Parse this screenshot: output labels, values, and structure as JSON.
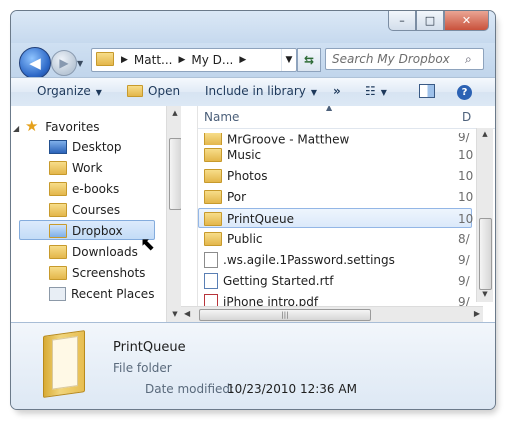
{
  "window": {
    "caption_buttons": {
      "minimize": "–",
      "maximize": "□",
      "close": "✕"
    }
  },
  "nav": {
    "back": "◀",
    "forward": "▶",
    "address": [
      "Matt...",
      "My D..."
    ],
    "search_placeholder": "Search My Dropbox"
  },
  "toolbar": {
    "organize": "Organize",
    "open": "Open",
    "include": "Include in library",
    "more": "»"
  },
  "sidebar": {
    "favorites": "Favorites",
    "items": [
      {
        "label": "Desktop",
        "icon": "desktop-icon"
      },
      {
        "label": "Work",
        "icon": "folder-icon"
      },
      {
        "label": "e-books",
        "icon": "folder-icon"
      },
      {
        "label": "Courses",
        "icon": "folder-icon"
      },
      {
        "label": "Dropbox",
        "icon": "dropbox-folder-icon",
        "selected": true
      },
      {
        "label": "Downloads",
        "icon": "downloads-icon"
      },
      {
        "label": "Screenshots",
        "icon": "folder-icon"
      },
      {
        "label": "Recent Places",
        "icon": "recent-places-icon"
      }
    ]
  },
  "files": {
    "column_name": "Name",
    "column_date": "D",
    "rows": [
      {
        "name": "MrGroove - Matthew",
        "date": "9/",
        "icon": "dropbox-folder-icon"
      },
      {
        "name": "Music",
        "date": "10",
        "icon": "dropbox-folder-icon"
      },
      {
        "name": "Photos",
        "date": "10",
        "icon": "dropbox-folder-icon"
      },
      {
        "name": "Por",
        "date": "10",
        "icon": "dropbox-folder-icon"
      },
      {
        "name": "PrintQueue",
        "date": "10",
        "icon": "dropbox-folder-icon",
        "selected": true
      },
      {
        "name": "Public",
        "date": "8/",
        "icon": "dropbox-folder-icon"
      },
      {
        "name": ".ws.agile.1Password.settings",
        "date": "9/",
        "icon": "file-icon"
      },
      {
        "name": "Getting Started.rtf",
        "date": "9/",
        "icon": "rtf-icon"
      },
      {
        "name": "iPhone intro.pdf",
        "date": "9/",
        "icon": "pdf-icon"
      }
    ]
  },
  "details": {
    "name": "PrintQueue",
    "type": "File folder",
    "modified_label": "Date modified:",
    "modified_value": "10/23/2010 12:36 AM"
  }
}
